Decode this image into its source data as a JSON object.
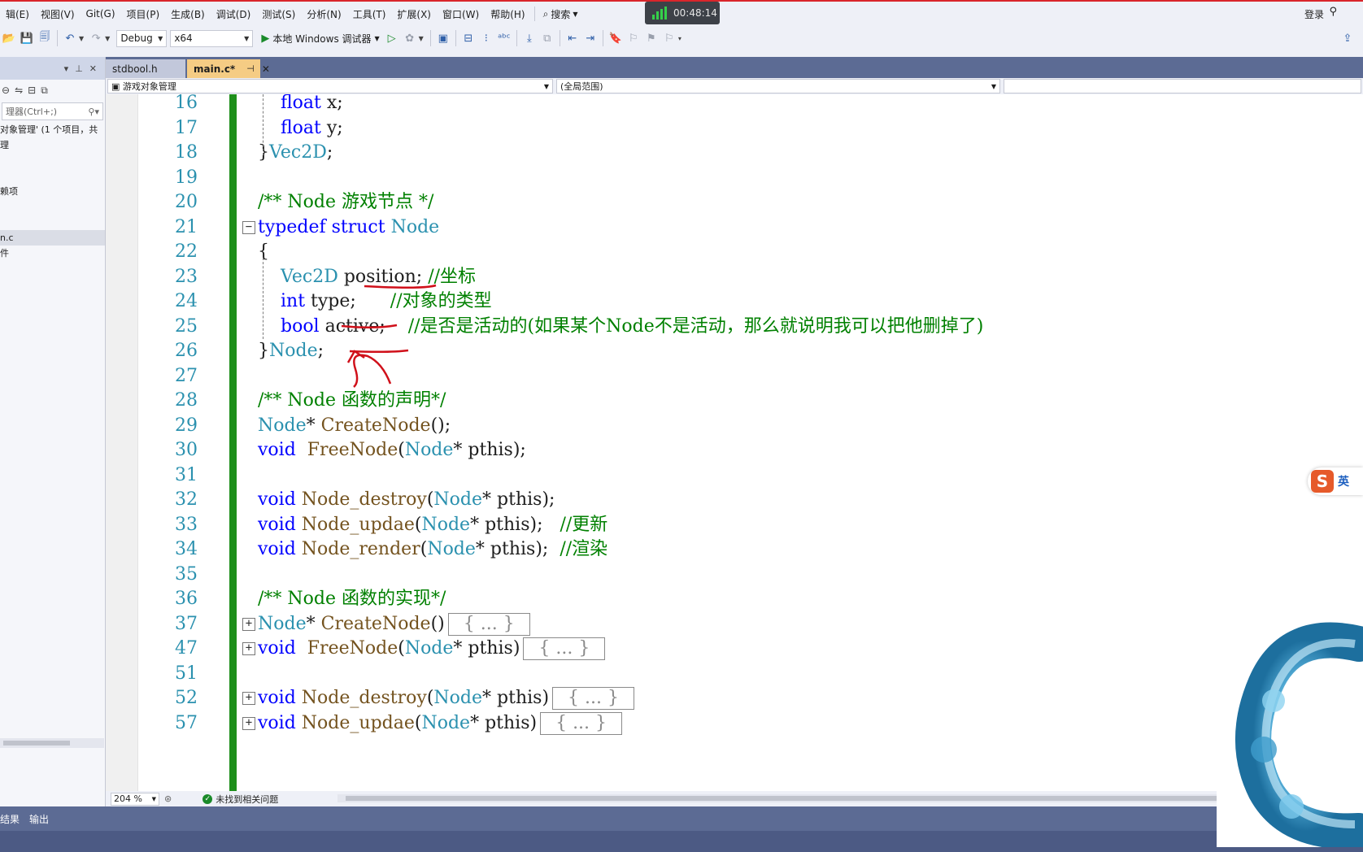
{
  "menu": {
    "items": [
      "辑(E)",
      "视图(V)",
      "Git(G)",
      "项目(P)",
      "生成(B)",
      "调试(D)",
      "测试(S)",
      "分析(N)",
      "工具(T)",
      "扩展(X)",
      "窗口(W)",
      "帮助(H)"
    ],
    "search_label": "搜索",
    "timer": "00:48:14",
    "login": "登录"
  },
  "toolbar": {
    "config": "Debug",
    "platform": "x64",
    "run_label": "本地 Windows 调试器"
  },
  "left_panel": {
    "search_placeholder": "理器(Ctrl+;)",
    "items": [
      "对象管理' (1 个项目，共",
      "理",
      "",
      "",
      "赖项",
      "",
      "",
      "n.c",
      "件"
    ]
  },
  "tabs": [
    {
      "label": "stdbool.h",
      "active": false
    },
    {
      "label": "main.c*",
      "active": true
    }
  ],
  "nav": {
    "project": "游戏对象管理",
    "scope": "(全局范围)"
  },
  "code_lines": [
    {
      "num": "16",
      "parts": [
        [
          "tx",
          "    "
        ],
        [
          "kw",
          "float"
        ],
        [
          "id",
          " x;"
        ]
      ]
    },
    {
      "num": "17",
      "parts": [
        [
          "tx",
          "    "
        ],
        [
          "kw",
          "float"
        ],
        [
          "id",
          " y;"
        ]
      ]
    },
    {
      "num": "18",
      "parts": [
        [
          "id",
          "}"
        ],
        [
          "ty",
          "Vec2D"
        ],
        [
          "id",
          ";"
        ]
      ]
    },
    {
      "num": "19",
      "parts": []
    },
    {
      "num": "20",
      "parts": [
        [
          "cm",
          "/** Node 游戏节点 */"
        ]
      ]
    },
    {
      "num": "21",
      "parts": [
        [
          "kw",
          "typedef struct "
        ],
        [
          "ty",
          "Node"
        ]
      ]
    },
    {
      "num": "22",
      "parts": [
        [
          "id",
          "{"
        ]
      ]
    },
    {
      "num": "23",
      "parts": [
        [
          "tx",
          "    "
        ],
        [
          "ty",
          "Vec2D"
        ],
        [
          "id",
          " position; "
        ],
        [
          "cm",
          "//坐标"
        ]
      ]
    },
    {
      "num": "24",
      "parts": [
        [
          "tx",
          "    "
        ],
        [
          "kw",
          "int"
        ],
        [
          "id",
          " type;      "
        ],
        [
          "cm",
          "//对象的类型"
        ]
      ]
    },
    {
      "num": "25",
      "parts": [
        [
          "tx",
          "    "
        ],
        [
          "kw",
          "bool"
        ],
        [
          "id",
          " active;    "
        ],
        [
          "cm",
          "//是否是活动的(如果某个Node不是活动，那么就说明我可以把他删掉了)"
        ]
      ]
    },
    {
      "num": "26",
      "parts": [
        [
          "id",
          "}"
        ],
        [
          "ty",
          "Node"
        ],
        [
          "id",
          ";"
        ]
      ]
    },
    {
      "num": "27",
      "parts": []
    },
    {
      "num": "28",
      "parts": [
        [
          "cm",
          "/** Node 函数的声明*/"
        ]
      ]
    },
    {
      "num": "29",
      "parts": [
        [
          "ty",
          "Node"
        ],
        [
          "id",
          "* "
        ],
        [
          "fn",
          "CreateNode"
        ],
        [
          "id",
          "();"
        ]
      ]
    },
    {
      "num": "30",
      "parts": [
        [
          "kw",
          "void"
        ],
        [
          "id",
          "  "
        ],
        [
          "fn",
          "FreeNode"
        ],
        [
          "id",
          "("
        ],
        [
          "ty",
          "Node"
        ],
        [
          "id",
          "* pthis);"
        ]
      ]
    },
    {
      "num": "31",
      "parts": []
    },
    {
      "num": "32",
      "parts": [
        [
          "kw",
          "void"
        ],
        [
          "id",
          " "
        ],
        [
          "fn",
          "Node_destroy"
        ],
        [
          "id",
          "("
        ],
        [
          "ty",
          "Node"
        ],
        [
          "id",
          "* pthis);"
        ]
      ]
    },
    {
      "num": "33",
      "parts": [
        [
          "kw",
          "void"
        ],
        [
          "id",
          " "
        ],
        [
          "fn",
          "Node_updae"
        ],
        [
          "id",
          "("
        ],
        [
          "ty",
          "Node"
        ],
        [
          "id",
          "* pthis);   "
        ],
        [
          "cm",
          "//更新"
        ]
      ]
    },
    {
      "num": "34",
      "parts": [
        [
          "kw",
          "void"
        ],
        [
          "id",
          " "
        ],
        [
          "fn",
          "Node_render"
        ],
        [
          "id",
          "("
        ],
        [
          "ty",
          "Node"
        ],
        [
          "id",
          "* pthis);  "
        ],
        [
          "cm",
          "//渲染"
        ]
      ]
    },
    {
      "num": "35",
      "parts": []
    },
    {
      "num": "36",
      "parts": [
        [
          "cm",
          "/** Node 函数的实现*/"
        ]
      ]
    },
    {
      "num": "37",
      "parts": [
        [
          "ty",
          "Node"
        ],
        [
          "id",
          "* "
        ],
        [
          "fn",
          "CreateNode"
        ],
        [
          "id",
          "()"
        ]
      ],
      "collapsed": "{ ... }"
    },
    {
      "num": "47",
      "parts": [
        [
          "kw",
          "void"
        ],
        [
          "id",
          "  "
        ],
        [
          "fn",
          "FreeNode"
        ],
        [
          "id",
          "("
        ],
        [
          "ty",
          "Node"
        ],
        [
          "id",
          "* pthis)"
        ]
      ],
      "collapsed": "{ ... }"
    },
    {
      "num": "51",
      "parts": []
    },
    {
      "num": "52",
      "parts": [
        [
          "kw",
          "void"
        ],
        [
          "id",
          " "
        ],
        [
          "fn",
          "Node_destroy"
        ],
        [
          "id",
          "("
        ],
        [
          "ty",
          "Node"
        ],
        [
          "id",
          "* pthis)"
        ]
      ],
      "collapsed": "{ ... }"
    },
    {
      "num": "57",
      "parts": [
        [
          "kw",
          "void"
        ],
        [
          "id",
          " "
        ],
        [
          "fn",
          "Node_updae"
        ],
        [
          "id",
          "("
        ],
        [
          "ty",
          "Node"
        ],
        [
          "id",
          "* pthis)"
        ]
      ],
      "collapsed": "{ ... }"
    }
  ],
  "status": {
    "zoom": "204 %",
    "issues": "未找到相关问题"
  },
  "bottom_tabs": [
    "结果",
    "输出"
  ],
  "ime": {
    "logo": "S",
    "lang": "英"
  }
}
